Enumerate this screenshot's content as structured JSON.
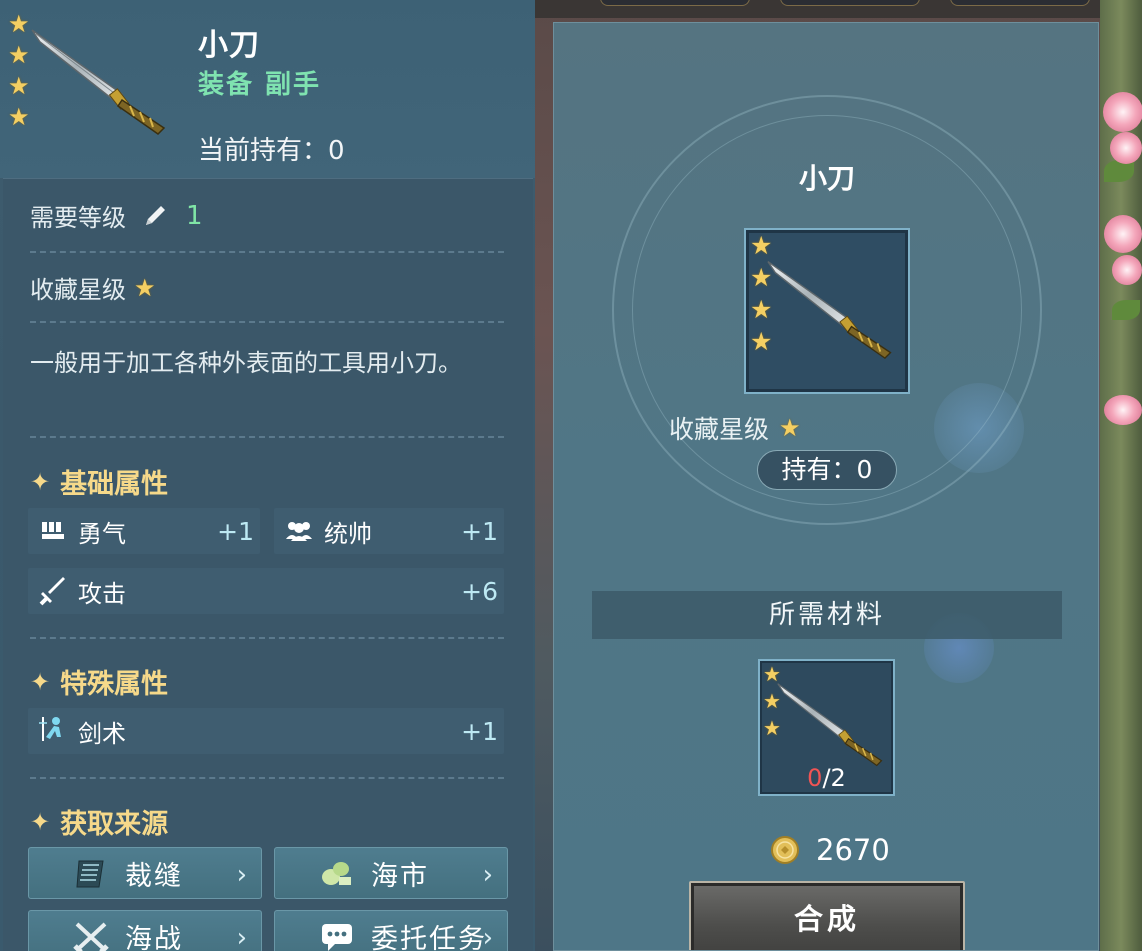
{
  "item": {
    "name": "小刀",
    "type_label": "装备 副手",
    "held_label": "当前持有：0",
    "rarity_stars": 4
  },
  "requirements": {
    "level_label": "需要等级",
    "level_value": "1",
    "collect_star_label": "收藏星级"
  },
  "description": "一般用于加工各种外表面的工具用小刀。",
  "sections": {
    "basic": "基础属性",
    "special": "特殊属性",
    "source": "获取来源"
  },
  "basic_stats": [
    {
      "label": "勇气",
      "value": "+1",
      "icon": "courage-icon"
    },
    {
      "label": "统帅",
      "value": "+1",
      "icon": "leadership-icon"
    },
    {
      "label": "攻击",
      "value": "+6",
      "icon": "sword-icon"
    }
  ],
  "special_stats": [
    {
      "label": "剑术",
      "value": "+1",
      "icon": "swordsmanship-icon"
    }
  ],
  "sources": [
    {
      "label": "裁缝",
      "icon": "tailor-icon"
    },
    {
      "label": "海市",
      "icon": "sea-market-icon"
    },
    {
      "label": "海战",
      "icon": "naval-battle-icon"
    },
    {
      "label": "委托任务",
      "icon": "commission-icon"
    }
  ],
  "craft": {
    "name": "小刀",
    "collect_star_label": "收藏星级",
    "owned_label": "持有：0",
    "materials_header": "所需材料",
    "material": {
      "stars": 3,
      "have": "0",
      "need": "/2"
    },
    "cost": "2670",
    "button": "合成"
  },
  "colors": {
    "star": "#f4cf63",
    "type_green": "#7fe3b0",
    "section_gold": "#f6d98a",
    "insufficient_red": "#f05454"
  }
}
